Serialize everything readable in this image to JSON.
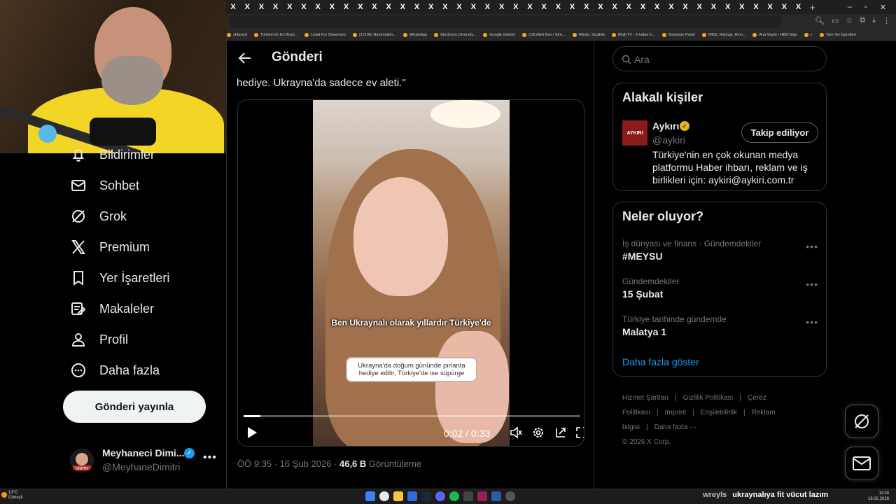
{
  "browser": {
    "tab_glyph": "X",
    "tab_count": 41,
    "new_tab": "+",
    "bookmarks": [
      "shboard",
      "Türkiye'nin En Büyü...",
      "Livad For Streamers",
      "(17145) Rammstein...",
      "WhatsApp",
      "Electronic Diversity...",
      "Google Gemini",
      "(19) Alert Box / Stre...",
      "Windy: Sıcaklık",
      "Multi TV - 6 haber k...",
      "Streamer Panel",
      "IMDb: Ratings, Revi...",
      "Ana Sayfa • HBO Max",
      "»",
      "Tüm Yer İşaretleri"
    ]
  },
  "nav": {
    "items": [
      {
        "label": "Bildirimler",
        "icon": "bell-icon"
      },
      {
        "label": "Sohbet",
        "icon": "mail-icon"
      },
      {
        "label": "Grok",
        "icon": "grok-icon"
      },
      {
        "label": "Premium",
        "icon": "x-logo-icon"
      },
      {
        "label": "Yer İşaretleri",
        "icon": "bookmark-icon"
      },
      {
        "label": "Makaleler",
        "icon": "article-icon"
      },
      {
        "label": "Profil",
        "icon": "person-icon"
      },
      {
        "label": "Daha fazla",
        "icon": "more-circle-icon"
      }
    ],
    "post_button": "Gönderi yayınla",
    "profile": {
      "name": "Meyhaneci Dimi...",
      "handle": "@MeyhaneDimitri",
      "avatar_text": "DIMITR"
    }
  },
  "post": {
    "header_title": "Gönderi",
    "text_tail": "hediye. Ukrayna'da sadece ev aleti.\"",
    "video": {
      "subtitle_main": "Ben Ukraynalı olarak yıllardır Türkiye'de",
      "subtitle_box": "Ukrayna'da doğum gününde pırlanta hediye edilir, Türkiye'de ise süpürge",
      "time": "0:02 / 0:33",
      "progress": 0.05
    },
    "timestamp": "ÖÖ 9:35 · 16 Şub 2026 · ",
    "views_count": "46,6 B",
    "views_label": " Görüntüleme"
  },
  "sidebar": {
    "search_placeholder": "Ara",
    "related": {
      "title": "Alakalı kişiler",
      "logo_text": "AYKIRI",
      "name": "Aykırı",
      "handle": "@aykiri",
      "follow_label": "Takip ediliyor",
      "bio": "Türkiye'nin en çok okunan medya platformu Haber ihbarı, reklam ve iş birlikleri için: aykiri@aykiri.com.tr"
    },
    "trends": {
      "title": "Neler oluyor?",
      "items": [
        {
          "context": "İş dünyası ve finans · Gündemdekiler",
          "name": "#MEYSU"
        },
        {
          "context": "Gündemdekiler",
          "name": "15 Şubat"
        },
        {
          "context": "Türkiye tarihinde gündemde",
          "name": "Malatya 1"
        }
      ],
      "show_more": "Daha fazla göster"
    },
    "footer": {
      "links": [
        "Hizmet Şartları",
        "|",
        "Gizlilik Politikası",
        "|",
        "Çerez Politikası",
        "|",
        "Imprint",
        "|",
        "Erişilebilirlik",
        "|",
        "Reklam bilgisi",
        "|",
        "Daha fazla ···"
      ],
      "copyright": "© 2026 X Corp."
    }
  },
  "taskbar": {
    "weather_temp": "13°C",
    "weather_desc": "Güneşli",
    "ticker_user": "wreyls",
    "ticker_text": "ukraynalıya fit vücut lazım",
    "time": "11:03",
    "date": "16.02.2026"
  },
  "colors": {
    "accent": "#1d9bf0",
    "bg": "#000000",
    "border": "#2f3336",
    "muted": "#71767b"
  }
}
